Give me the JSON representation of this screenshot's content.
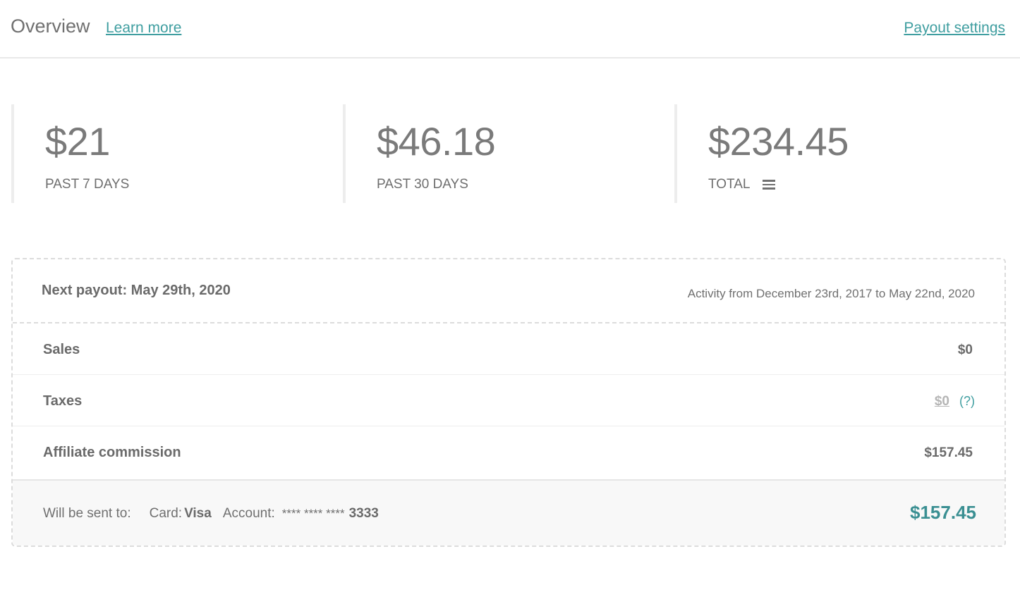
{
  "header": {
    "title": "Overview",
    "learn_more": "Learn more",
    "payout_settings": "Payout settings"
  },
  "stats": [
    {
      "amount": "$21",
      "label": "PAST 7 DAYS"
    },
    {
      "amount": "$46.18",
      "label": "PAST 30 DAYS"
    },
    {
      "amount": "$234.45",
      "label": "TOTAL"
    }
  ],
  "payout": {
    "next": "Next payout: May 29th, 2020",
    "activity": "Activity from December 23rd, 2017 to May 22nd, 2020",
    "rows": [
      {
        "label": "Sales",
        "value": "$0"
      },
      {
        "label": "Taxes",
        "value": "$0",
        "help": "(?)"
      },
      {
        "label": "Affiliate commission",
        "value": "$157.45"
      }
    ],
    "footer": {
      "sent_to": "Will be sent to:",
      "card_key": "Card:",
      "card_value": "Visa",
      "account_key": "Account:",
      "account_masked": "**** **** ****",
      "account_last4": "3333",
      "total": "$157.45"
    }
  },
  "colors": {
    "accent": "#3f9ea0",
    "text": "#6a6a6a",
    "border": "#dcdcdc"
  }
}
